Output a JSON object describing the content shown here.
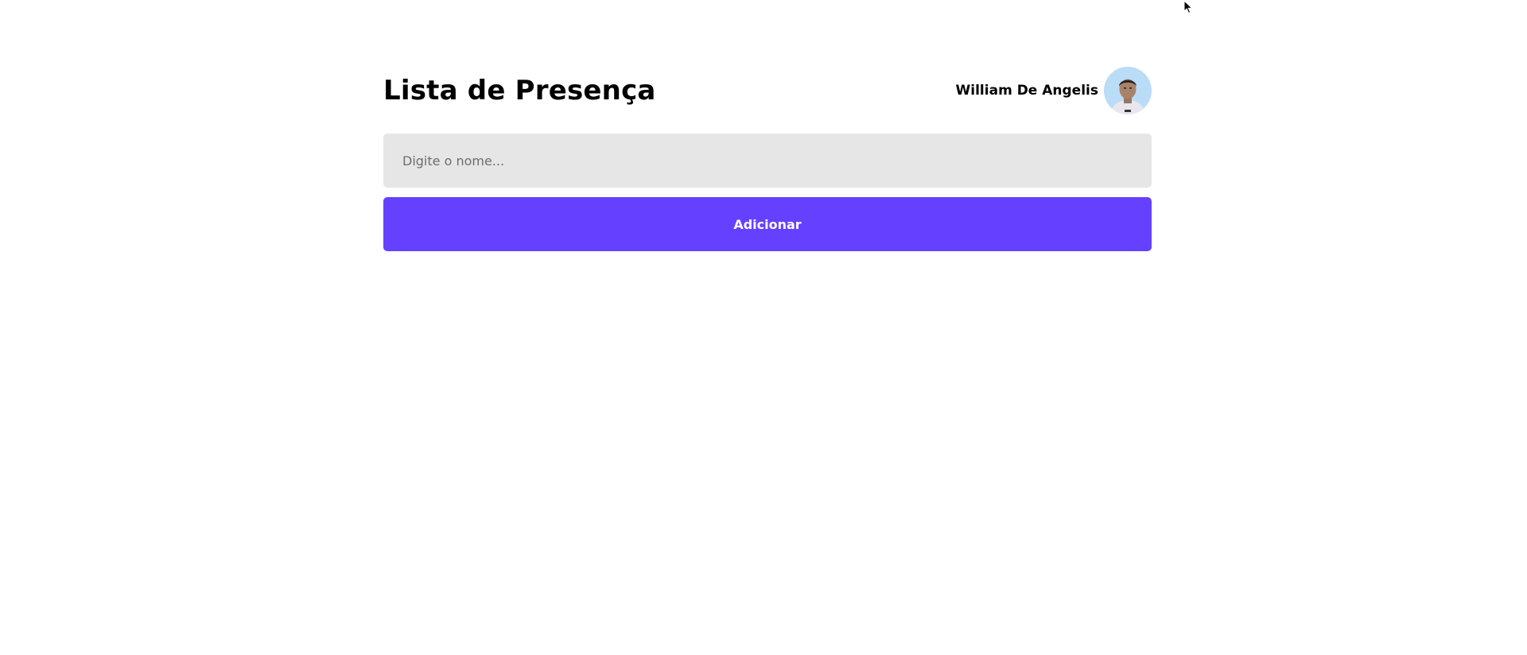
{
  "header": {
    "title": "Lista de Presença",
    "user_name": "William De Angelis",
    "avatar_icon": "user-avatar-photo"
  },
  "form": {
    "name_input": {
      "value": "",
      "placeholder": "Digite o nome..."
    },
    "add_button_label": "Adicionar"
  },
  "colors": {
    "accent": "#6541ff",
    "input_background": "#e6e6e6",
    "page_background": "#ffffff",
    "text": "#000000"
  }
}
